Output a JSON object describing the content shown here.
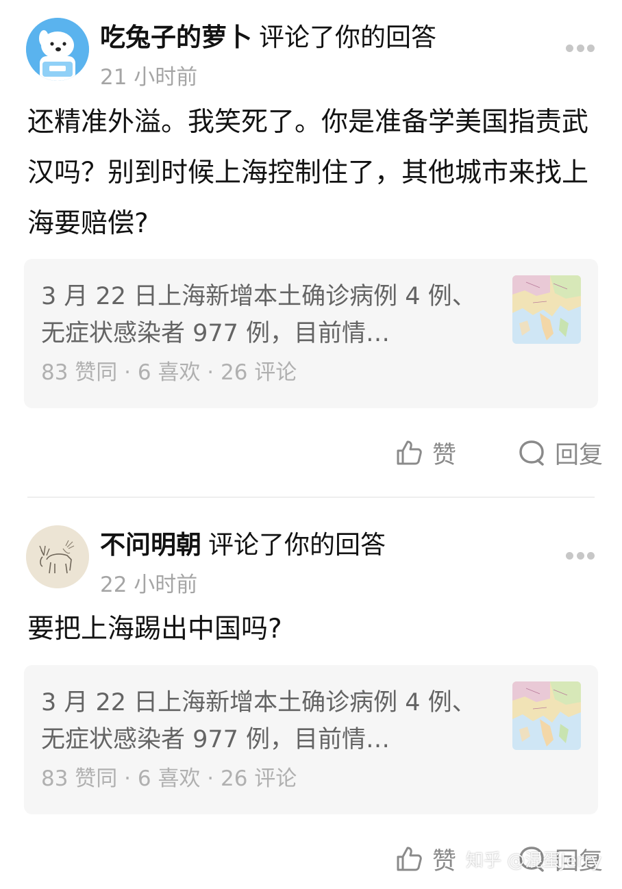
{
  "notifications": [
    {
      "username": "吃兔子的萝卜",
      "action": "评论了你的回答",
      "time": "21 小时前",
      "comment": "还精准外溢。我笑死了。你是准备学美国指责武汉吗？别到时候上海控制住了，其他城市来找上海要赔偿?",
      "avatar_icon": "cartoon-dog-astronaut-icon",
      "card": {
        "title": "3 月 22 日上海新增本土确诊病例 4 例、无症状感染者 977 例，目前情…",
        "stats": "83 赞同 · 6 喜欢 · 26 评论",
        "thumb_icon": "map-thumbnail-icon"
      },
      "like_label": "赞",
      "reply_label": "回复"
    },
    {
      "username": "不问明朝",
      "action": "评论了你的回答",
      "time": "22 小时前",
      "comment": "要把上海踢出中国吗?",
      "avatar_icon": "moose-sketch-icon",
      "card": {
        "title": "3 月 22 日上海新增本土确诊病例 4 例、无症状感染者 977 例，目前情…",
        "stats": "83 赞同 · 6 喜欢 · 26 评论",
        "thumb_icon": "map-thumbnail-icon"
      },
      "like_label": "赞",
      "reply_label": "回复"
    }
  ],
  "watermark": "知乎 @混蛋Jerry",
  "colors": {
    "text_primary": "#121212",
    "text_secondary": "#a5a5a5",
    "card_bg": "#f6f6f6",
    "action_gray": "#8a8a8a",
    "avatar_blue": "#4aa9e8"
  }
}
